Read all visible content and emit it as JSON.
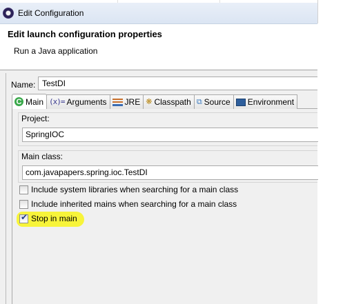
{
  "window": {
    "title": "Edit Configuration"
  },
  "header": {
    "title": "Edit launch configuration properties",
    "subtitle": "Run a Java application"
  },
  "name_field": {
    "label": "Name:",
    "value": "TestDI"
  },
  "tabs": [
    {
      "label": "Main",
      "icon": "main-icon",
      "active": true
    },
    {
      "label": "Arguments",
      "icon": "arguments-icon",
      "active": false
    },
    {
      "label": "JRE",
      "icon": "jre-icon",
      "active": false
    },
    {
      "label": "Classpath",
      "icon": "classpath-icon",
      "active": false
    },
    {
      "label": "Source",
      "icon": "source-icon",
      "active": false
    },
    {
      "label": "Environment",
      "icon": "environment-icon",
      "active": false
    }
  ],
  "tab_icon_glyphs": {
    "main": "C",
    "arguments": "(x)=",
    "classpath": "❋",
    "source": "⧉"
  },
  "project": {
    "label": "Project:",
    "value": "SpringIOC"
  },
  "main_class": {
    "label": "Main class:",
    "value": "com.javapapers.spring.ioc.TestDI"
  },
  "options": [
    {
      "label": "Include system libraries when searching for a main class",
      "checked": false
    },
    {
      "label": "Include inherited mains when searching for a main class",
      "checked": false
    },
    {
      "label": "Stop in main",
      "checked": true
    }
  ],
  "check_glyph": "✔",
  "colors": {
    "highlight": "#f7f43a",
    "titlebar": "#dbe5f3",
    "panel": "#f0f0f0",
    "main_tab_icon": "#39a84a"
  }
}
